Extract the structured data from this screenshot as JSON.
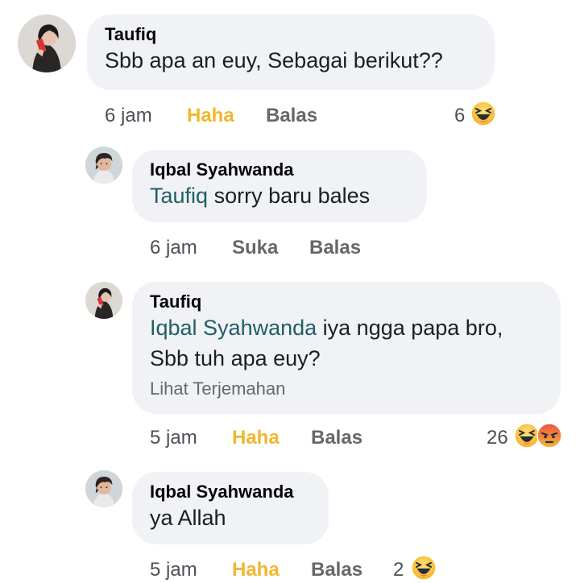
{
  "comments": [
    {
      "author": "Taufiq",
      "text": "Sbb apa an euy, Sebagai berikut??",
      "time": "6 jam",
      "reaction_action": "Haha",
      "reply": "Balas",
      "reaction_count": "6",
      "reactions": [
        "haha-emoji"
      ]
    },
    {
      "author": "Iqbal Syahwanda",
      "mention": "Taufiq",
      "text": " sorry baru bales",
      "time": "6 jam",
      "reaction_action": "Suka",
      "reply": "Balas"
    },
    {
      "author": "Taufiq",
      "mention": "Iqbal Syahwanda",
      "text_line1": " iya ngga papa bro,",
      "text_line2": "Sbb tuh apa euy?",
      "translate": "Lihat Terjemahan",
      "time": "5 jam",
      "reaction_action": "Haha",
      "reply": "Balas",
      "reaction_count": "26",
      "reactions": [
        "haha-emoji",
        "angry-emoji"
      ]
    },
    {
      "author": "Iqbal Syahwanda",
      "text": "ya Allah",
      "time": "5 jam",
      "reaction_action": "Haha",
      "reply": "Balas",
      "reaction_count": "2",
      "reactions": [
        "haha-emoji"
      ]
    }
  ],
  "colors": {
    "bubble": "#f0f2f5",
    "haha_active": "#f0b72f",
    "mention": "#1f5f66",
    "meta": "#65676b"
  }
}
